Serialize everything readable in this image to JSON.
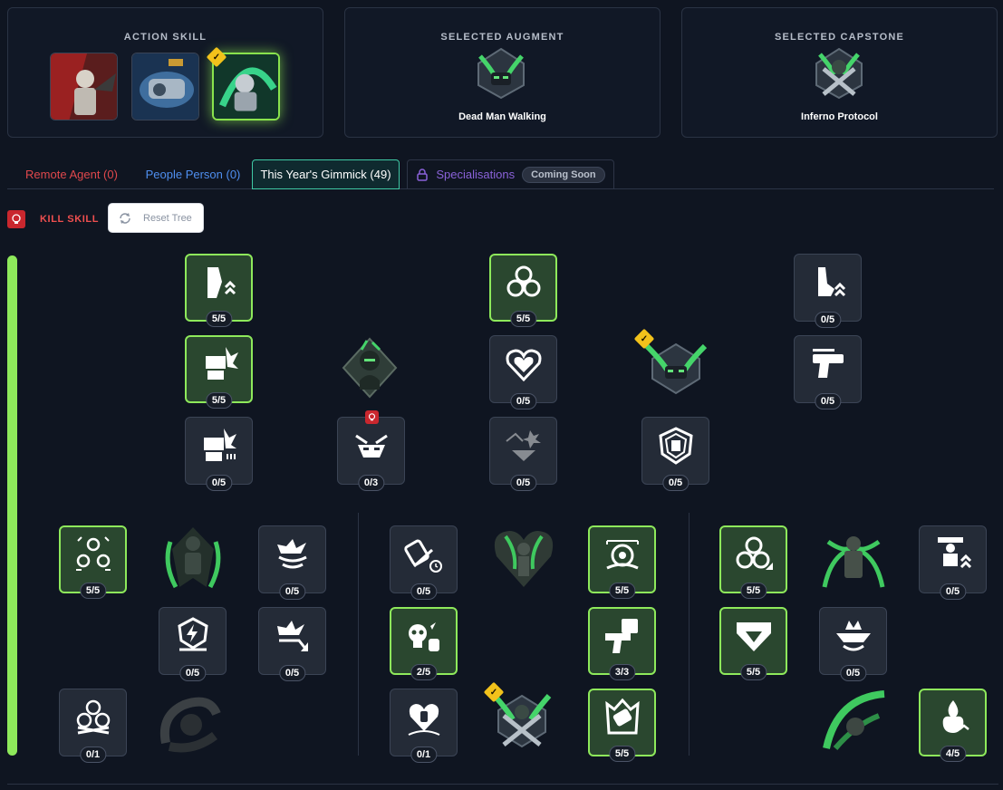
{
  "header": {
    "action_skill": {
      "title": "ACTION SKILL",
      "skills": [
        "action-skill-red",
        "action-skill-blue",
        "action-skill-green"
      ],
      "selected_index": 2
    },
    "augment": {
      "title": "SELECTED AUGMENT",
      "name": "Dead Man Walking"
    },
    "capstone": {
      "title": "SELECTED CAPSTONE",
      "name": "Inferno Protocol"
    }
  },
  "tabs": [
    {
      "label": "Remote Agent (0)",
      "color": "#e0484c"
    },
    {
      "label": "People Person (0)",
      "color": "#4f8ff0"
    },
    {
      "label": "This Year's Gimmick (49)",
      "color": "#ffffff"
    },
    {
      "label": "Specialisations",
      "badge": "Coming Soon",
      "color": "#8a62d9"
    }
  ],
  "toolbar": {
    "kill_skill_label": "KILL SKILL",
    "reset_label": "Reset Tree"
  },
  "colors": {
    "accent": "#8ee95b",
    "kill": "#c9272e",
    "teal": "#3fc9a5"
  },
  "nodes": [
    {
      "id": "n1",
      "icon": "arm-upgrade-icon",
      "points": "5/5",
      "filled": true
    },
    {
      "id": "n2",
      "icon": "biohazard-icon",
      "points": "5/5",
      "filled": true
    },
    {
      "id": "n3",
      "icon": "boot-upgrade-icon",
      "points": "0/5"
    },
    {
      "id": "n4",
      "icon": "fist-impact-icon",
      "points": "5/5",
      "filled": true
    },
    {
      "id": "n5",
      "icon": "heart-shield-icon",
      "points": "0/5"
    },
    {
      "id": "n6",
      "icon": "pistol-icon",
      "points": "0/5"
    },
    {
      "id": "n7",
      "icon": "fist-ammo-icon",
      "points": "0/5"
    },
    {
      "id": "n8",
      "icon": "masked-face-icon",
      "points": "0/3",
      "kill_skill": true
    },
    {
      "id": "n9",
      "icon": "explosion-chevron-icon",
      "points": "0/5",
      "dim": true
    },
    {
      "id": "n10",
      "icon": "fist-badge-icon",
      "points": "0/5"
    },
    {
      "id": "n11",
      "icon": "triple-biohazard-icon",
      "points": "5/5",
      "filled": true
    },
    {
      "id": "n12",
      "icon": "burst-swirl-icon",
      "points": "0/5"
    },
    {
      "id": "n13",
      "icon": "lightning-shield-icon",
      "points": "0/5"
    },
    {
      "id": "n14",
      "icon": "burst-arrow-icon",
      "points": "0/5"
    },
    {
      "id": "n15",
      "icon": "biohazard-skull-icon",
      "points": "0/1"
    },
    {
      "id": "n16",
      "icon": "grenade-timer-icon",
      "points": "0/5"
    },
    {
      "id": "n17",
      "icon": "mine-icon",
      "points": "5/5",
      "filled": true
    },
    {
      "id": "n18",
      "icon": "skull-grenade-icon",
      "points": "2/5",
      "filled": true
    },
    {
      "id": "n19",
      "icon": "pistol-fist-icon",
      "points": "3/3",
      "filled": true
    },
    {
      "id": "n20",
      "icon": "heart-bottle-icon",
      "points": "0/1"
    },
    {
      "id": "n21",
      "icon": "grenade-crown-icon",
      "points": "5/5",
      "filled": true
    },
    {
      "id": "n22",
      "icon": "biohazard-arrow-icon",
      "points": "5/5",
      "filled": true
    },
    {
      "id": "n23",
      "icon": "figure-upgrade-icon",
      "points": "0/5"
    },
    {
      "id": "n24",
      "icon": "chevron-shield-icon",
      "points": "5/5",
      "filled": true
    },
    {
      "id": "n25",
      "icon": "crown-wings-icon",
      "points": "0/5"
    },
    {
      "id": "n26",
      "icon": "flame-upgrade-icon",
      "points": "4/5",
      "filled": true
    }
  ],
  "emblems": [
    "head-emblem",
    "augment-emblem-active",
    "figure-emblem-left",
    "figure-emblem-mid",
    "figure-emblem-right",
    "swirl-emblem",
    "capstone-emblem-active",
    "slash-emblem"
  ]
}
